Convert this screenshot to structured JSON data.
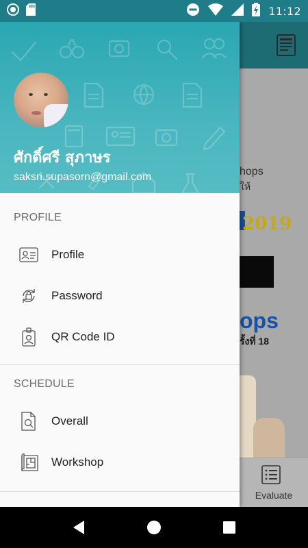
{
  "status_bar": {
    "time": "11:12",
    "icons": [
      "notification-dot-icon",
      "sd-card-icon",
      "do-not-disturb-icon",
      "wifi-icon",
      "cellular-signal-icon",
      "battery-charging-icon"
    ]
  },
  "background_app": {
    "text_line1": "hops",
    "text_line2": "ให้",
    "banner_year": "2019",
    "headline": "ops",
    "thai_sub": "รั้งที่ 18",
    "bottom_nav_label": "Evaluate"
  },
  "drawer": {
    "header": {
      "user_name": "ศักดิ์ศรี สุภาษร",
      "email": "saksri.supasorn@gmail.com",
      "accent_color": "#2aa7b2"
    },
    "sections": [
      {
        "title": "PROFILE",
        "items": [
          {
            "label": "Profile",
            "icon": "id-card-icon"
          },
          {
            "label": "Password",
            "icon": "lock-refresh-icon"
          },
          {
            "label": "QR Code ID",
            "icon": "id-badge-icon"
          }
        ]
      },
      {
        "title": "SCHEDULE",
        "items": [
          {
            "label": "Overall",
            "icon": "document-search-icon"
          },
          {
            "label": "Workshop",
            "icon": "blueprint-icon"
          }
        ]
      }
    ]
  },
  "nav_bar": {
    "buttons": [
      "back-icon",
      "home-icon",
      "recents-icon"
    ]
  }
}
